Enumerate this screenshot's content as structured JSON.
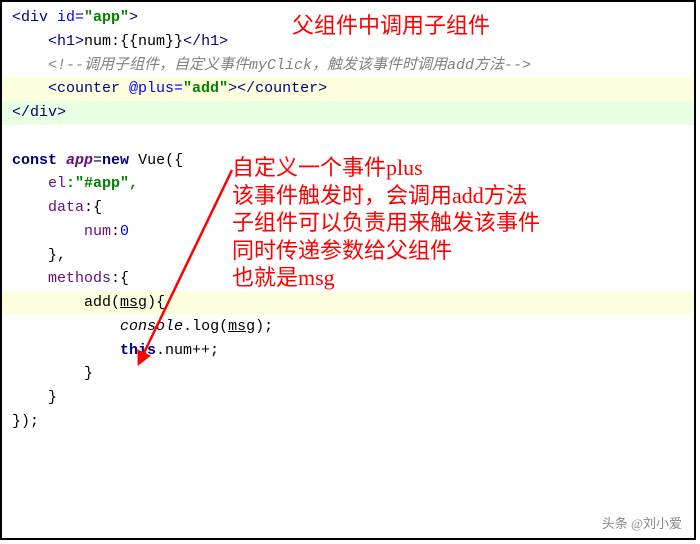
{
  "code": {
    "l1_open": "<div ",
    "l1_id_attr": "id=",
    "l1_id_val": "\"app\"",
    "l1_close": ">",
    "l2_indent": "    ",
    "l2_h1o": "<h1>",
    "l2_txt": "num:{{num}}",
    "l2_h1c": "</h1>",
    "l3_indent": "    ",
    "l3_cmt": "<!--调用子组件，自定义事件myClick，触发该事件时调用add方法-->",
    "l4_indent": "    ",
    "l4_o": "<counter ",
    "l4_attr": "@plus=",
    "l4_val": "\"add\"",
    "l4_c": "></counter>",
    "l5": "</div>",
    "l7_const": "const ",
    "l7_app": "app",
    "l7_eq": "=",
    "l7_new": "new ",
    "l7_vue": "Vue({",
    "l8_indent": "    ",
    "l8_key": "el",
    "l8_val": ":\"#app\",",
    "l9_indent": "    ",
    "l9_key": "data",
    "l9_val": ":{",
    "l10_indent": "        ",
    "l10_key": "num",
    "l10_val": ":",
    "l10_num": "0",
    "l11_indent": "    ",
    "l11_txt": "},",
    "l12_indent": "    ",
    "l12_key": "methods",
    "l12_val": ":{",
    "l13_indent": "        ",
    "l13_add": "add",
    "l13_p1": "(",
    "l13_msg": "msg",
    "l13_p2": "){",
    "l14_indent": "            ",
    "l14_console": "console",
    "l14_dot": ".",
    "l14_log": "log(",
    "l14_msg": "msg",
    "l14_end": ");",
    "l15_indent": "            ",
    "l15_this": "this",
    "l15_txt": ".num++;",
    "l16_indent": "        ",
    "l16_txt": "}",
    "l17_indent": "    ",
    "l17_txt": "}",
    "l18": "});"
  },
  "anno": {
    "top": "父组件中调用子组件",
    "block": "自定义一个事件plus\n该事件触发时，会调用add方法\n子组件可以负责用来触发该事件\n同时传递参数给父组件\n也就是msg"
  },
  "footer": "头条 @刘小爱"
}
